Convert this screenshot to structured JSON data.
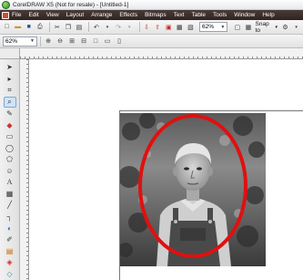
{
  "window": {
    "title": "CorelDRAW X5 (Not for resale) - [Untitled-1]"
  },
  "menu": {
    "items": [
      {
        "label": "File"
      },
      {
        "label": "Edit"
      },
      {
        "label": "View"
      },
      {
        "label": "Layout"
      },
      {
        "label": "Arrange"
      },
      {
        "label": "Effects"
      },
      {
        "label": "Bitmaps"
      },
      {
        "label": "Text"
      },
      {
        "label": "Table"
      },
      {
        "label": "Tools"
      },
      {
        "label": "Window"
      },
      {
        "label": "Help"
      }
    ]
  },
  "toolbar": {
    "zoom_value": "62%",
    "snap_label": "Snap to"
  },
  "propbar": {
    "zoom_value": "62%"
  },
  "icons": {
    "new": "new-document-icon",
    "open": "open-folder-icon",
    "save": "save-icon",
    "print": "print-icon",
    "cut": "cut-icon",
    "copy": "copy-icon",
    "paste": "paste-icon",
    "undo": "undo-icon",
    "redo": "redo-icon",
    "import": "import-icon",
    "export": "export-icon",
    "zoom_in": "zoom-in-icon",
    "zoom_out": "zoom-out-icon"
  },
  "colors": {
    "ellipse_stroke": "#e01010",
    "menubar_bg": "#3a2e2a",
    "active_tool": "#cfe3f7"
  }
}
